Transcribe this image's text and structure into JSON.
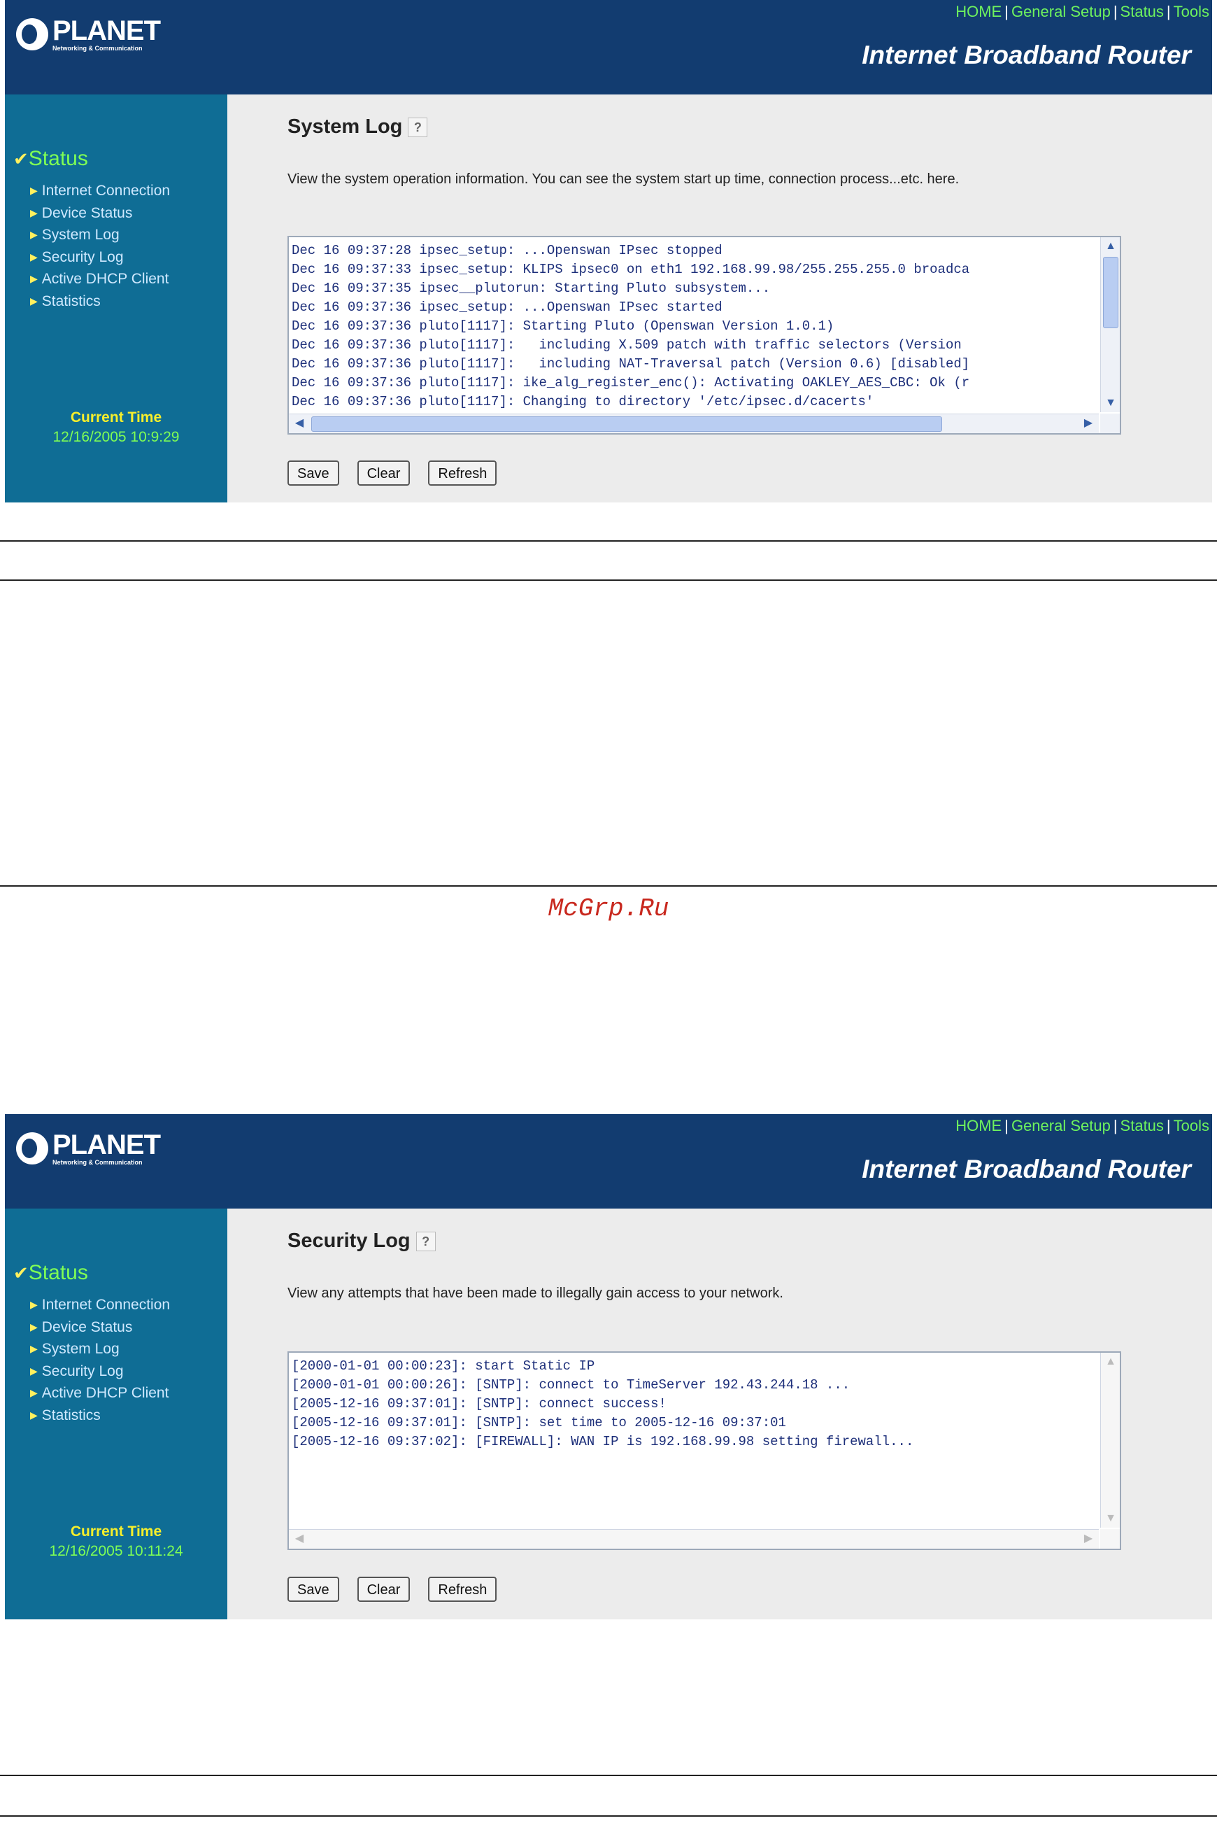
{
  "header": {
    "logo_name": "PLANET",
    "logo_sub": "Networking & Communication",
    "nav": [
      "HOME",
      "General Setup",
      "Status",
      "Tools"
    ],
    "nav_sep": "|",
    "product": "Internet Broadband Router"
  },
  "sidebar": {
    "check": "✔",
    "section": "Status",
    "items": [
      "Internet Connection",
      "Device Status",
      "System Log",
      "Security Log",
      "Active DHCP Client",
      "Statistics"
    ],
    "current_time_label": "Current Time"
  },
  "system_log": {
    "title": "System Log",
    "description": "View the system operation information. You can see the system start up time, connection process...etc. here.",
    "current_time": "12/16/2005 10:9:29",
    "log": "Dec 16 09:37:28 ipsec_setup: ...Openswan IPsec stopped\nDec 16 09:37:33 ipsec_setup: KLIPS ipsec0 on eth1 192.168.99.98/255.255.255.0 broadca\nDec 16 09:37:35 ipsec__plutorun: Starting Pluto subsystem...\nDec 16 09:37:36 ipsec_setup: ...Openswan IPsec started\nDec 16 09:37:36 pluto[1117]: Starting Pluto (Openswan Version 1.0.1)\nDec 16 09:37:36 pluto[1117]:   including X.509 patch with traffic selectors (Version\nDec 16 09:37:36 pluto[1117]:   including NAT-Traversal patch (Version 0.6) [disabled]\nDec 16 09:37:36 pluto[1117]: ike_alg_register_enc(): Activating OAKLEY_AES_CBC: Ok (r\nDec 16 09:37:36 pluto[1117]: Changing to directory '/etc/ipsec.d/cacerts'"
  },
  "security_log": {
    "title": "Security Log",
    "description": "View any attempts that have been made to illegally gain access to your network.",
    "current_time": "12/16/2005 10:11:24",
    "log": "[2000-01-01 00:00:23]: start Static IP\n[2000-01-01 00:00:26]: [SNTP]: connect to TimeServer 192.43.244.18 ...\n[2005-12-16 09:37:01]: [SNTP]: connect success!\n[2005-12-16 09:37:01]: [SNTP]: set time to 2005-12-16 09:37:01\n[2005-12-16 09:37:02]: [FIREWALL]: WAN IP is 192.168.99.98 setting firewall..."
  },
  "buttons": {
    "save": "Save",
    "clear": "Clear",
    "refresh": "Refresh"
  },
  "help_glyph": "?",
  "watermark": "McGrp.Ru",
  "colors": {
    "header_bg": "#123c70",
    "sidebar_bg": "#0f6d95",
    "nav_link": "#6ef25e",
    "status_green": "#7fff55",
    "time_label": "#f7ef2b",
    "log_text": "#1d2f7a"
  }
}
